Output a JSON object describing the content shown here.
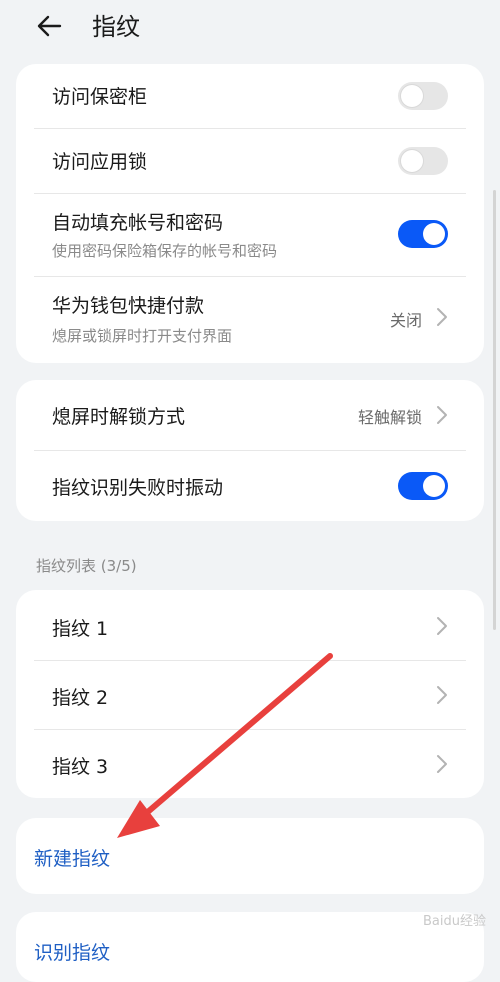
{
  "header": {
    "title": "指纹"
  },
  "group1": {
    "rows": [
      {
        "label": "访问保密柜",
        "toggle": "off"
      },
      {
        "label": "访问应用锁",
        "toggle": "off"
      },
      {
        "label": "自动填充帐号和密码",
        "sub": "使用密码保险箱保存的帐号和密码",
        "toggle": "on"
      },
      {
        "label": "华为钱包快捷付款",
        "sub": "熄屏或锁屏时打开支付界面",
        "value": "关闭"
      }
    ]
  },
  "group2": {
    "rows": [
      {
        "label": "熄屏时解锁方式",
        "value": "轻触解锁"
      },
      {
        "label": "指纹识别失败时振动",
        "toggle": "on"
      }
    ]
  },
  "fingerprint_list": {
    "label": "指纹列表 (3/5)",
    "items": [
      "指纹 1",
      "指纹 2",
      "指纹 3"
    ]
  },
  "actions": {
    "new_fingerprint": "新建指纹",
    "identify_fingerprint": "识别指纹"
  },
  "watermark": "Baidu经验",
  "colors": {
    "accent": "#0a59f7",
    "link": "#1f5fc4",
    "annotation_arrow": "#e8403d"
  }
}
